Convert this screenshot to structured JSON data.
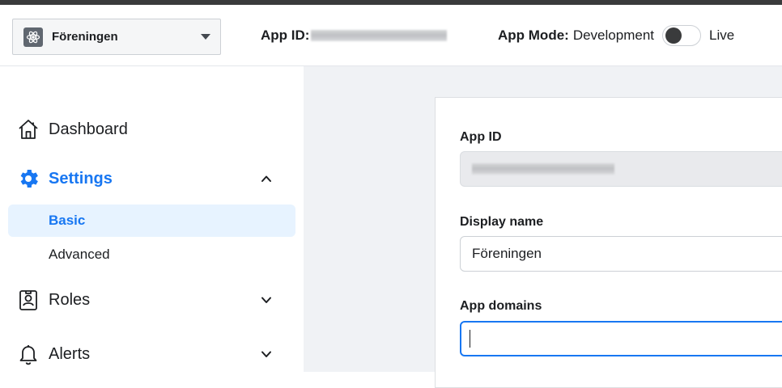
{
  "header": {
    "app_selector": {
      "name": "Föreningen",
      "icon": "atom-icon"
    },
    "app_id_label": "App ID:",
    "app_mode": {
      "label": "App Mode:",
      "value": "Development",
      "toggle_state": "off",
      "live_label": "Live"
    }
  },
  "sidebar": {
    "items": [
      {
        "label": "Dashboard",
        "icon": "home-icon"
      },
      {
        "label": "Settings",
        "icon": "gear-icon",
        "expanded": true,
        "children": [
          {
            "label": "Basic",
            "active": true
          },
          {
            "label": "Advanced",
            "active": false
          }
        ]
      },
      {
        "label": "Roles",
        "icon": "badge-icon",
        "expanded": false
      },
      {
        "label": "Alerts",
        "icon": "bell-icon",
        "expanded": false
      }
    ]
  },
  "form": {
    "app_id": {
      "label": "App ID"
    },
    "display_name": {
      "label": "Display name",
      "value": "Föreningen"
    },
    "app_domains": {
      "label": "App domains",
      "value": ""
    }
  },
  "colors": {
    "accent": "#1877f2",
    "active_bg": "#e7f3ff",
    "content_bg": "#f0f2f5"
  }
}
